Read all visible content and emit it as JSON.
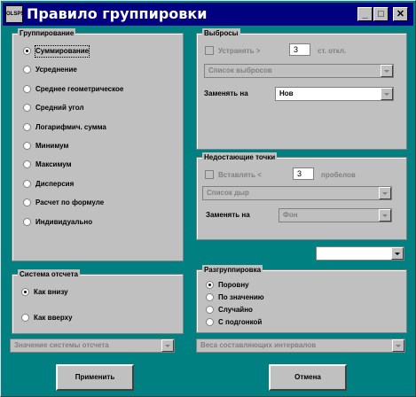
{
  "window": {
    "title": "Правило группировки",
    "icon_text": "OLSPS"
  },
  "titlebar_buttons": {
    "minimize": "_",
    "maximize": "□",
    "close": "✕"
  },
  "grouping": {
    "title": "Группирование",
    "options": [
      "Суммирование",
      "Усреднение",
      "Среднее геометрическое",
      "Средний угол",
      "Логарифмич. сумма",
      "Минимум",
      "Максимум",
      "Дисперсия",
      "Расчет по формуле",
      "Индивидуально"
    ],
    "selected": 0
  },
  "outliers": {
    "title": "Выбросы",
    "checkbox_label": "Устранять >",
    "value": "3",
    "unit": "ст. откл.",
    "list_placeholder": "Список выбросов",
    "replace_label": "Заменять на",
    "replace_value": "Нов"
  },
  "missing": {
    "title": "Недостающие точки",
    "checkbox_label": "Вставлять <",
    "value": "3",
    "unit": "пробелов",
    "list_placeholder": "Список дыр",
    "replace_label": "Заменять на",
    "replace_value": "Фон"
  },
  "small_combo": {
    "value": ""
  },
  "reference": {
    "title": "Система отсчета",
    "options": [
      "Как внизу",
      "Как вверху"
    ],
    "selected": 0,
    "combo_placeholder": "Значение системы отсчета"
  },
  "ungroup": {
    "title": "Разгруппировка",
    "options": [
      "Поровну",
      "По значению",
      "Случайно",
      "С подгонкой"
    ],
    "selected": 0,
    "combo_placeholder": "Веса составляющих интервалов"
  },
  "buttons": {
    "apply": "Применить",
    "cancel": "Отмена"
  },
  "colors": {
    "background": "#008080",
    "titlebar": "#000080",
    "face": "#c0c0c0"
  }
}
